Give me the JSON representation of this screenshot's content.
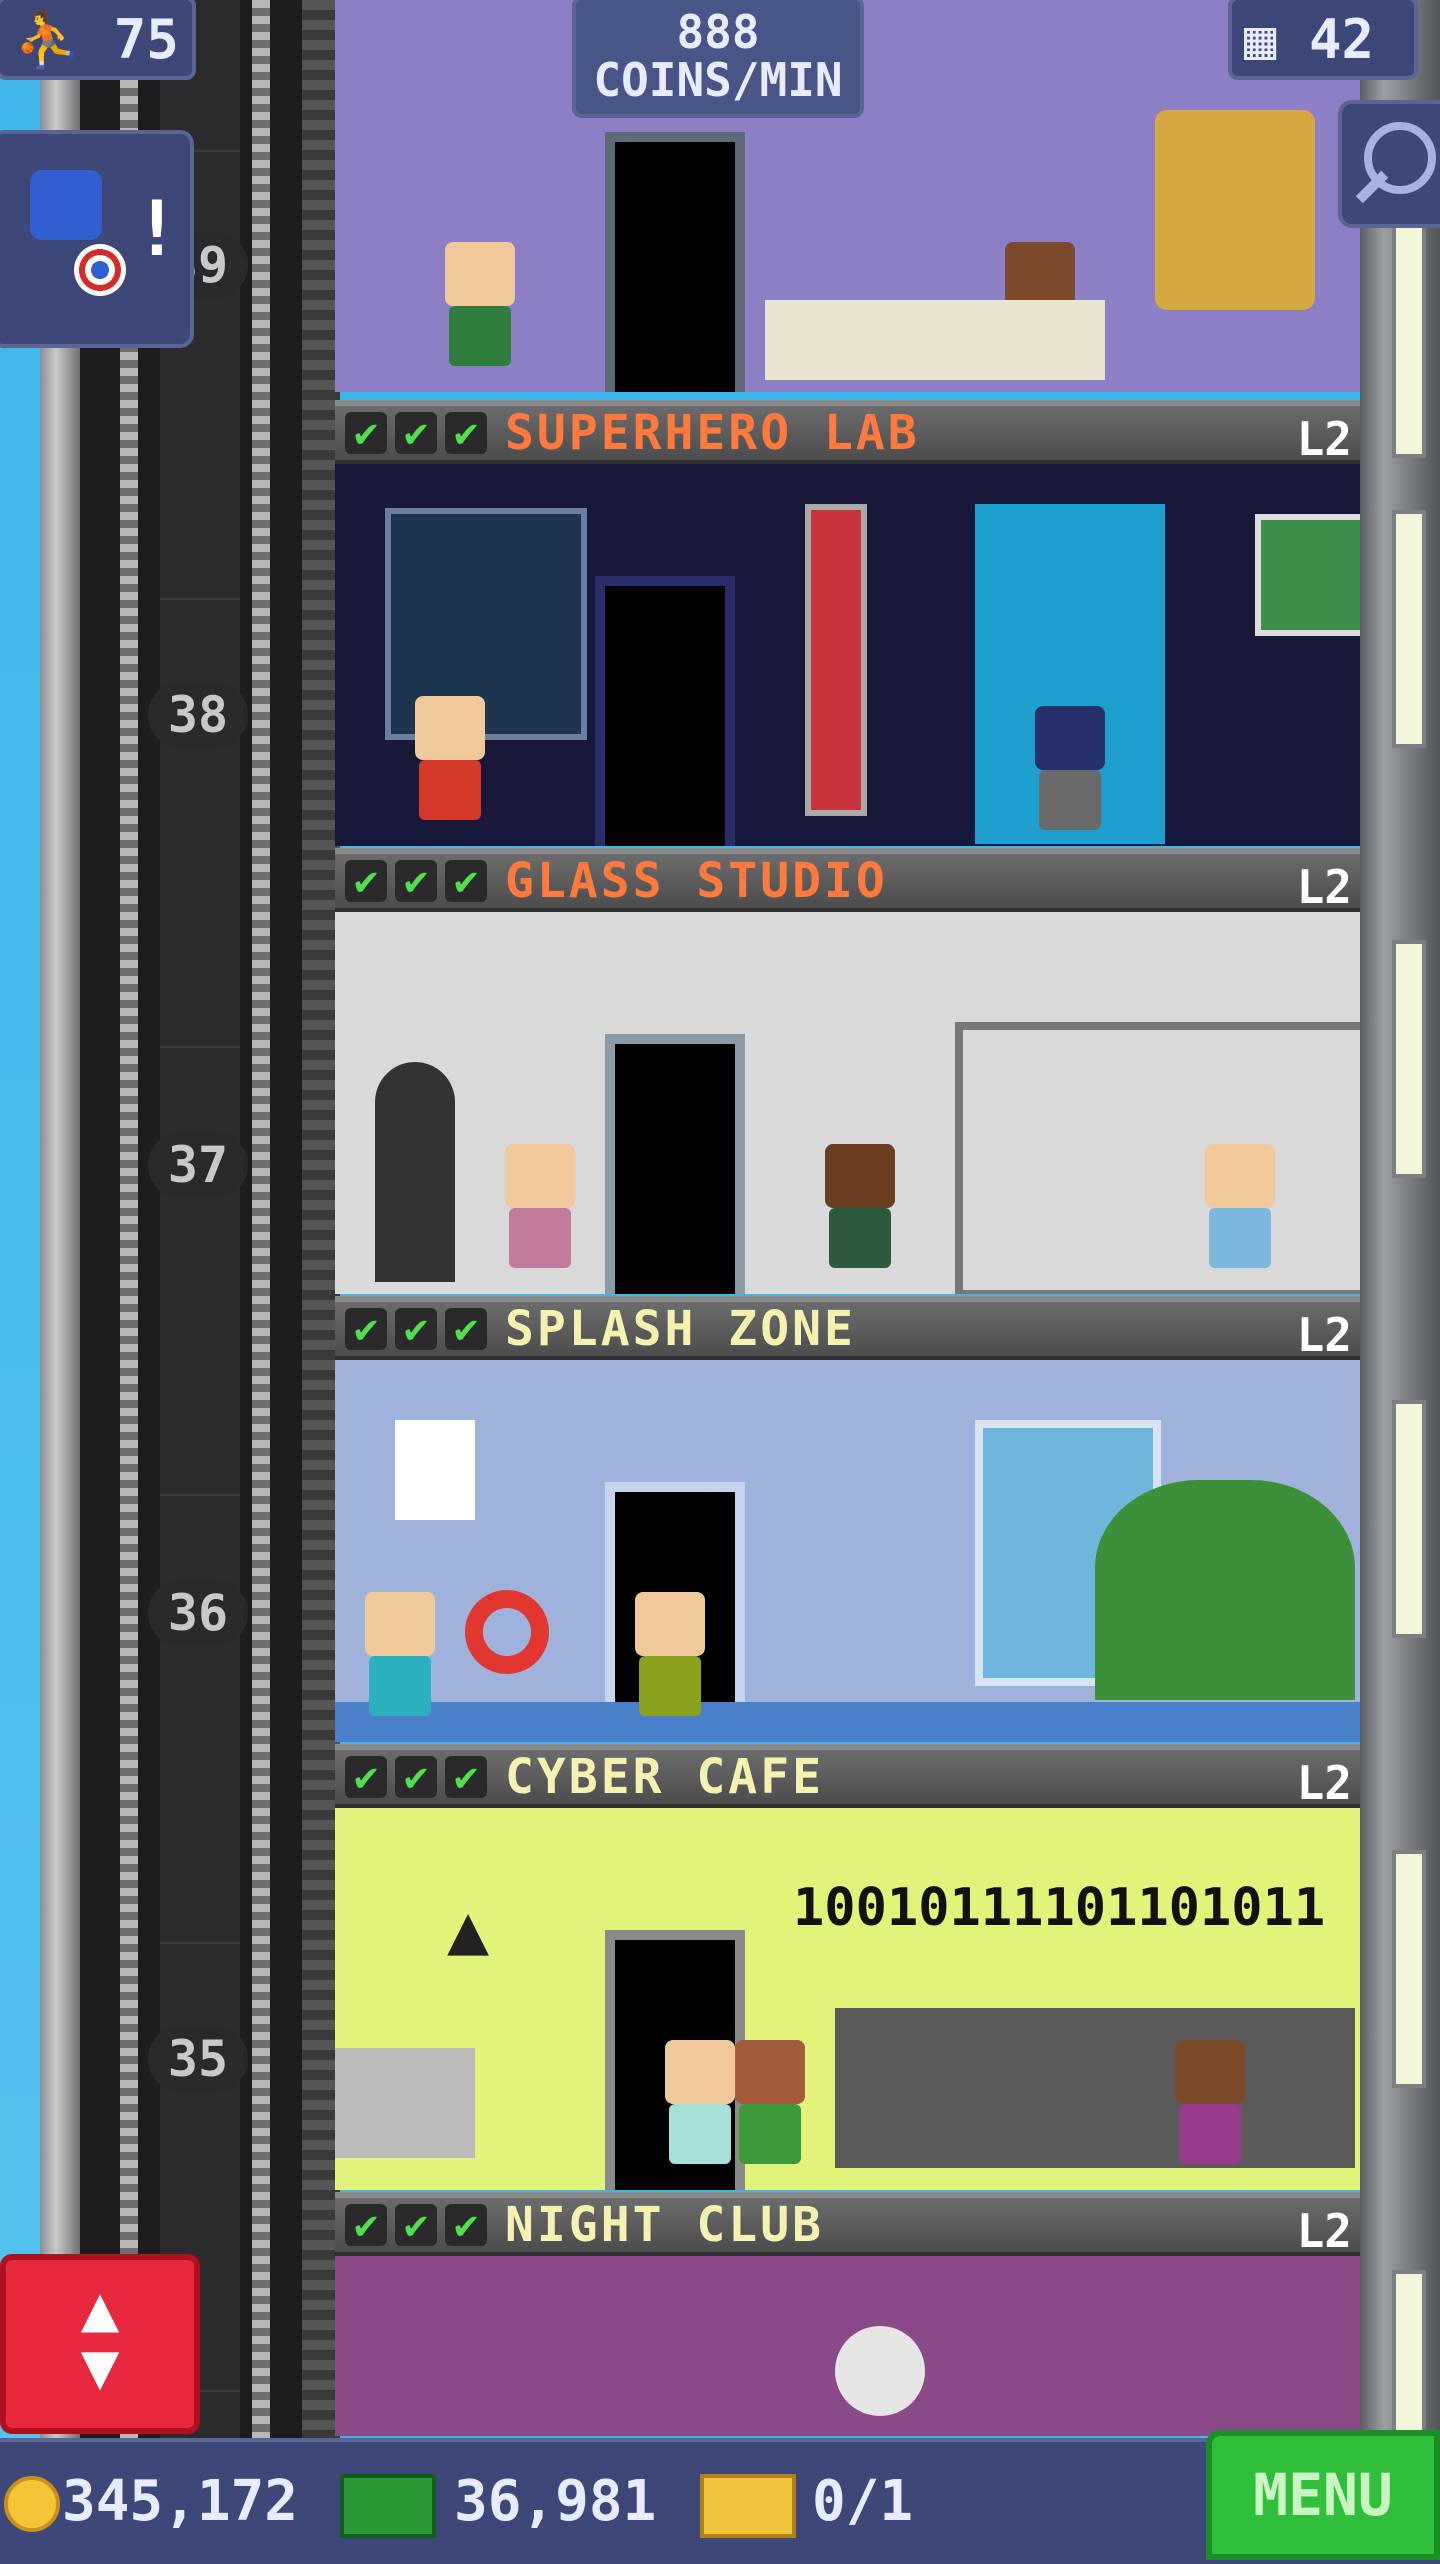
{
  "hud": {
    "population": "75",
    "floors": "42",
    "coins_per_min_value": "888",
    "coins_per_min_label": "COINS/MIN"
  },
  "elevator": {
    "floor_numbers": [
      "39",
      "38",
      "37",
      "36",
      "35"
    ]
  },
  "floors": [
    {
      "name": "SUPERHERO LAB",
      "level": "L2",
      "name_color": "#ff7a3c"
    },
    {
      "name": "GLASS STUDIO",
      "level": "L2",
      "name_color": "#ff7a3c"
    },
    {
      "name": "SPLASH ZONE",
      "level": "L2",
      "name_color": "#f5f2b0"
    },
    {
      "name": "CYBER CAFE",
      "level": "L2",
      "name_color": "#f5f2b0"
    },
    {
      "name": "NIGHT CLUB",
      "level": "L2",
      "name_color": "#f5f2b0"
    }
  ],
  "cyber_cafe_sign": "1001011110110101​1",
  "bottom_bar": {
    "coins": "345,172",
    "bux": "36,981",
    "vip": "0/1",
    "menu_label": "MENU"
  },
  "icons": [
    "person-icon",
    "building-icon",
    "search-icon",
    "superhero-icon",
    "elevator-arrows-icon",
    "coin-icon",
    "bux-icon",
    "vip-ticket-icon",
    "check-icon"
  ]
}
